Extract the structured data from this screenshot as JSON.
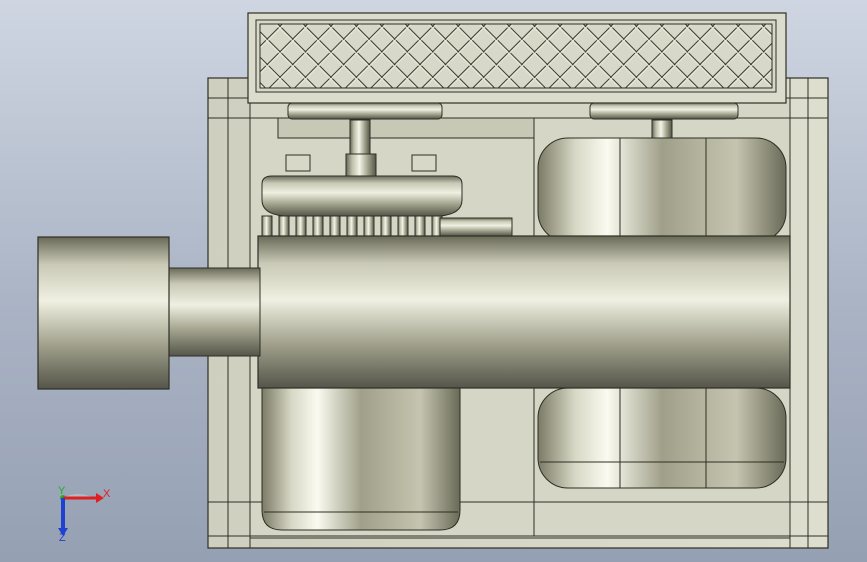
{
  "viewport": {
    "background_top": "#cfd6e2",
    "background_bottom": "#95a0b3"
  },
  "axis_triad": {
    "x_label": "X",
    "y_label": "Y",
    "z_label": "Z",
    "x_color": "#e02020",
    "y_color": "#20b020",
    "z_color": "#2040d0"
  },
  "colors": {
    "metal_light": "#e6e6d4",
    "metal_mid": "#a8a890",
    "metal_dark": "#5d5d4c",
    "frame": "#d4d4c4",
    "outline": "#2e2e24"
  }
}
